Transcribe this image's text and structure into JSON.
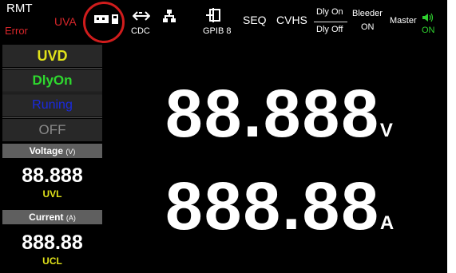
{
  "topbar": {
    "rmt": "RMT",
    "error": "Error",
    "uva": "UVA",
    "usb_icon": "usb-icon",
    "cdc_label": "CDC",
    "lan_icon": "lan-icon",
    "gpib_label": "GPIB 8",
    "seq": "SEQ",
    "cvhs": "CVHS",
    "dly_on": "Dly On",
    "dly_off": "Dly Off",
    "bleeder": "Bleeder",
    "bleeder_state": "ON",
    "master": "Master",
    "speaker_state": "ON"
  },
  "sidebar": {
    "statuses": [
      "UVD",
      "DlyOn",
      "Runing",
      "OFF"
    ],
    "voltage": {
      "title": "Voltage",
      "unit": "(V)",
      "value_main": "88.88",
      "value_highlight": "8",
      "limit_label": "UVL"
    },
    "current": {
      "title": "Current",
      "unit": "(A)",
      "value_main": "888.",
      "value_highlight": "8",
      "value_tail": "8",
      "limit_label": "UCL"
    }
  },
  "main": {
    "voltage_reading": "88.888",
    "voltage_unit": "V",
    "current_reading": "888.88",
    "current_unit": "A"
  },
  "colors": {
    "error_red": "#d8262a",
    "status_yellow": "#e0e21a",
    "status_green": "#2ed92e",
    "status_blue": "#1a2adf",
    "highlight_orange": "#ef9a20",
    "annotation_ring": "#d01c1c"
  }
}
